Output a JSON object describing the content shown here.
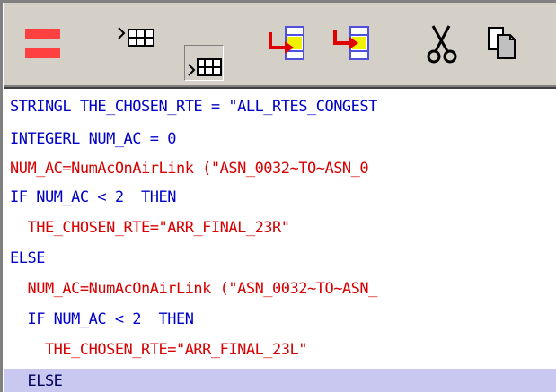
{
  "toolbar": {
    "buttons": [
      {
        "name": "equals-icon"
      },
      {
        "name": "insert-row-above-icon"
      },
      {
        "name": "insert-row-below-icon"
      },
      {
        "name": "move-right-icon"
      },
      {
        "name": "move-left-icon"
      },
      {
        "name": "cut-icon"
      },
      {
        "name": "copy-icon"
      }
    ]
  },
  "editor": {
    "lines": [
      {
        "text": "STRINGL THE_CHOSEN_RTE = \"ALL_RTES_CONGEST",
        "color": "#0000c8"
      },
      {
        "text": "INTEGERL NUM_AC = 0",
        "color": "#0000c8"
      },
      {
        "text": "NUM_AC=NumAcOnAirLink (\"ASN_0032~TO~ASN_0",
        "color": "#d80000"
      },
      {
        "text": "IF NUM_AC < 2  THEN",
        "color": "#0000c8"
      },
      {
        "text": "  THE_CHOSEN_RTE=\"ARR_FINAL_23R\"",
        "color": "#d80000"
      },
      {
        "text": "ELSE",
        "color": "#0000c8"
      },
      {
        "text": "  NUM_AC=NumAcOnAirLink (\"ASN_0032~TO~ASN_",
        "color": "#d80000"
      },
      {
        "text": "  IF NUM_AC < 2  THEN",
        "color": "#0000c8"
      },
      {
        "text": "    THE_CHOSEN_RTE=\"ARR_FINAL_23L\"",
        "color": "#d80000"
      },
      {
        "text": "  ELSE",
        "color": "#000060"
      }
    ]
  },
  "colors": {
    "keyword": "#0000c8",
    "assignment": "#d80000",
    "selection": "#c8c8f0",
    "toolbar_bg": "#d4d0c8"
  }
}
